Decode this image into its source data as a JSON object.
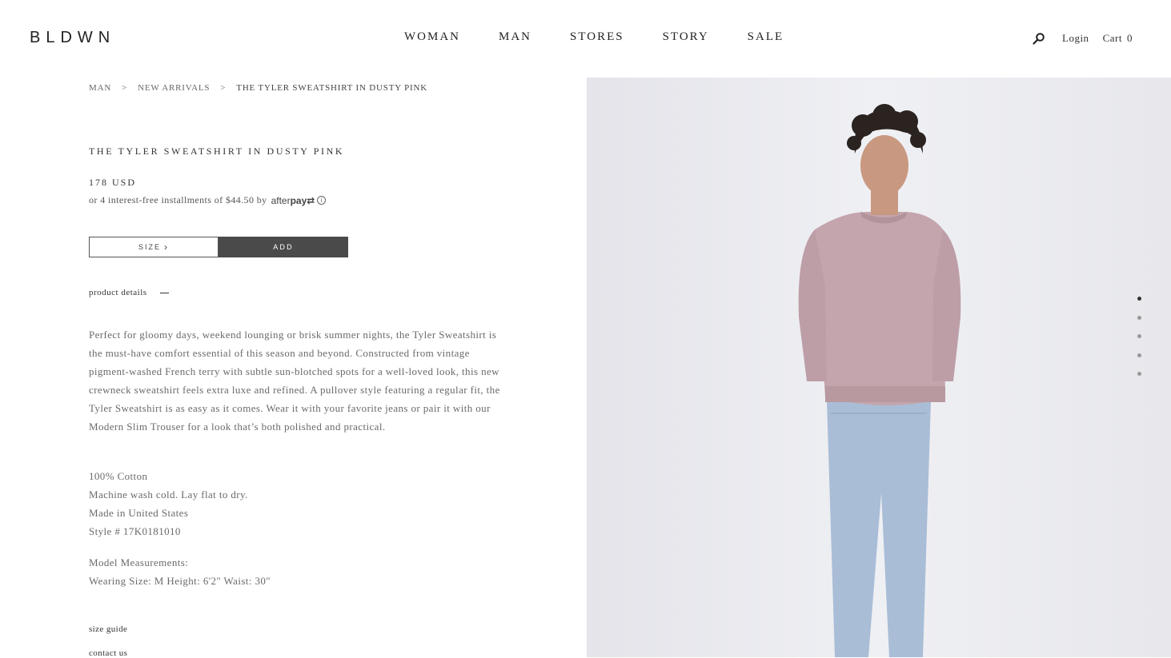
{
  "header": {
    "logo": "BLDWN",
    "nav": [
      "WOMAN",
      "MAN",
      "STORES",
      "STORY",
      "SALE"
    ],
    "login": "Login",
    "cart_label": "Cart",
    "cart_count": "0"
  },
  "breadcrumb": {
    "items": [
      "MAN",
      "NEW ARRIVALS",
      "THE TYLER SWEATSHIRT IN DUSTY PINK"
    ],
    "separator": ">"
  },
  "product": {
    "title": "THE TYLER SWEATSHIRT IN DUSTY PINK",
    "price": "178 USD",
    "installments": "or 4 interest-free installments of $44.50 by",
    "afterpay_pre": "after",
    "afterpay_bold": "pay",
    "afterpay_mark": "⇄",
    "info_glyph": "i",
    "size_label": "SIZE",
    "size_chevron": "›",
    "add_label": "ADD",
    "details_label": "product details",
    "description": "Perfect for gloomy days, weekend lounging or brisk summer nights, the Tyler Sweatshirt is the must-have comfort essential of this season and beyond. Constructed from vintage pigment-washed French terry with subtle sun-blotched spots for a well-loved look, this new crewneck sweatshirt feels extra luxe and refined. A pullover style featuring a regular fit, the Tyler Sweatshirt is as easy as it comes. Wear it with your favorite jeans or pair it with our Modern Slim Trouser for a look that’s both polished and practical.",
    "specs": [
      "100% Cotton",
      "Machine wash cold. Lay flat to dry.",
      "Made in United States",
      "Style # 17K0181010"
    ],
    "model_heading": "Model Measurements:",
    "model_values": "Wearing Size: M Height: 6'2\" Waist: 30\"",
    "size_guide": "size guide",
    "contact_us": "contact us"
  },
  "gallery": {
    "image_count": 5,
    "active_index": 0,
    "colors": {
      "sweatshirt": "#c4a5ad",
      "jeans": "#a9bdd6",
      "hair": "#2b2320",
      "skin": "#c99880",
      "background": "#e9e9ee"
    }
  }
}
